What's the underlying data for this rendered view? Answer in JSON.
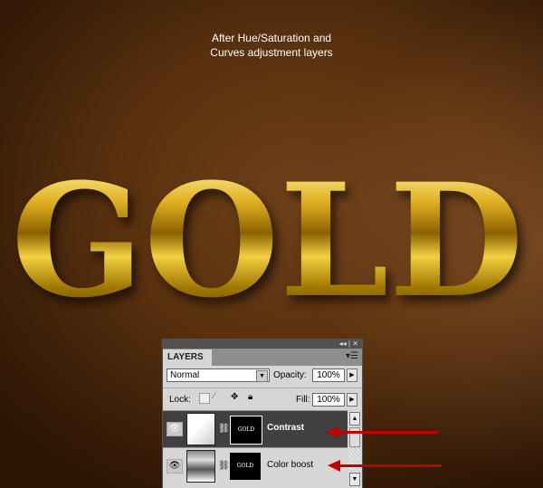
{
  "caption": {
    "line1": "After Hue/Saturation and",
    "line2": "Curves adjustment layers"
  },
  "artwork_text": "GOLD",
  "panel": {
    "title_controls": "◂◂ | ✕",
    "tab": "LAYERS",
    "blend_mode": "Normal",
    "opacity_label": "Opacity:",
    "opacity": "100%",
    "lock_label": "Lock:",
    "fill_label": "Fill:",
    "fill": "100%",
    "layers": [
      {
        "name": "Contrast",
        "mask_text": "GOLD",
        "selected": true
      },
      {
        "name": "Color boost",
        "mask_text": "GOLD",
        "selected": false
      }
    ]
  },
  "colors": {
    "arrow": "#c00000",
    "selected_layer": "#404040"
  }
}
